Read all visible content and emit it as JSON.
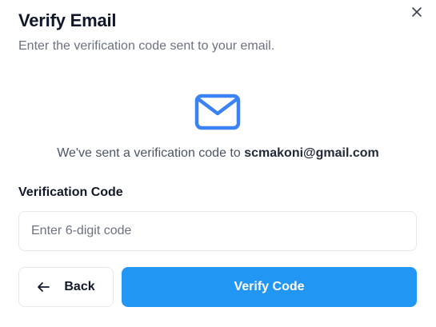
{
  "dialog": {
    "title": "Verify Email",
    "subtitle": "Enter the verification code sent to your email.",
    "close_icon": "close-icon"
  },
  "notice": {
    "icon": "mail-icon",
    "text_prefix": "We've sent a verification code to ",
    "email": "scmakoni@gmail.com"
  },
  "form": {
    "code_label": "Verification Code",
    "code_value": "",
    "code_placeholder": "Enter 6-digit code"
  },
  "actions": {
    "back_icon": "arrow-left-icon",
    "back_label": "Back",
    "verify_label": "Verify Code"
  },
  "colors": {
    "accent": "#2196f3",
    "mail_icon": "#3b82f6",
    "border": "#e5e7eb",
    "muted_text": "#6b7280"
  }
}
